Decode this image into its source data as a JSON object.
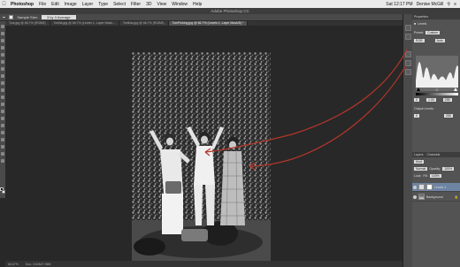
{
  "menubar": {
    "app_name": "Photoshop",
    "items": [
      "File",
      "Edit",
      "Image",
      "Layer",
      "Type",
      "Select",
      "Filter",
      "3D",
      "View",
      "Window",
      "Help"
    ],
    "clock": "Sat 12:17 PM",
    "user": "Denise McGill"
  },
  "window": {
    "title": "Adobe Photoshop CC"
  },
  "options_bar": {
    "sample_size_label": "Sample Size:",
    "sample_size_value": "3 by 3 Average"
  },
  "tabs": [
    {
      "label": "Tour.jpg @ 66.7% (RGB/8)",
      "active": false
    },
    {
      "label": "Tortilla.jpg @ 66.7% (Levels 1, Layer Mask...",
      "active": false
    },
    {
      "label": "Tortillas.jpg @ 66.7% (RGB/8)",
      "active": false
    },
    {
      "label": "TomPicking.jpg @ 66.7% (Levels 1, Layer Mask/8) *",
      "active": true
    }
  ],
  "status": {
    "zoom": "66.67%",
    "doc_size": "Doc: 3.64M/7.96M"
  },
  "properties": {
    "title": "Properties",
    "subtitle": "Levels",
    "preset_label": "Preset:",
    "preset_value": "Custom",
    "channel_value": "RGB",
    "auto_label": "Auto",
    "input_shadow": "0",
    "input_mid": "1.00",
    "input_highlight": "255",
    "output_label": "Output Levels:",
    "output_min": "0",
    "output_max": "255"
  },
  "layers_panel": {
    "tabs": [
      "Layers",
      "Channels"
    ],
    "kind_label": "Kind",
    "blend_mode": "Normal",
    "opacity_label": "Opacity:",
    "opacity_value": "100%",
    "lock_label": "Lock:",
    "fill_label": "Fill:",
    "fill_value": "100%",
    "layers": [
      {
        "name": "Levels 1",
        "selected": true
      },
      {
        "name": "Background",
        "selected": false
      }
    ]
  },
  "colors": {
    "annotation": "#b3362a",
    "selected_layer": "#6d84a3",
    "panel_bg": "#535353"
  }
}
